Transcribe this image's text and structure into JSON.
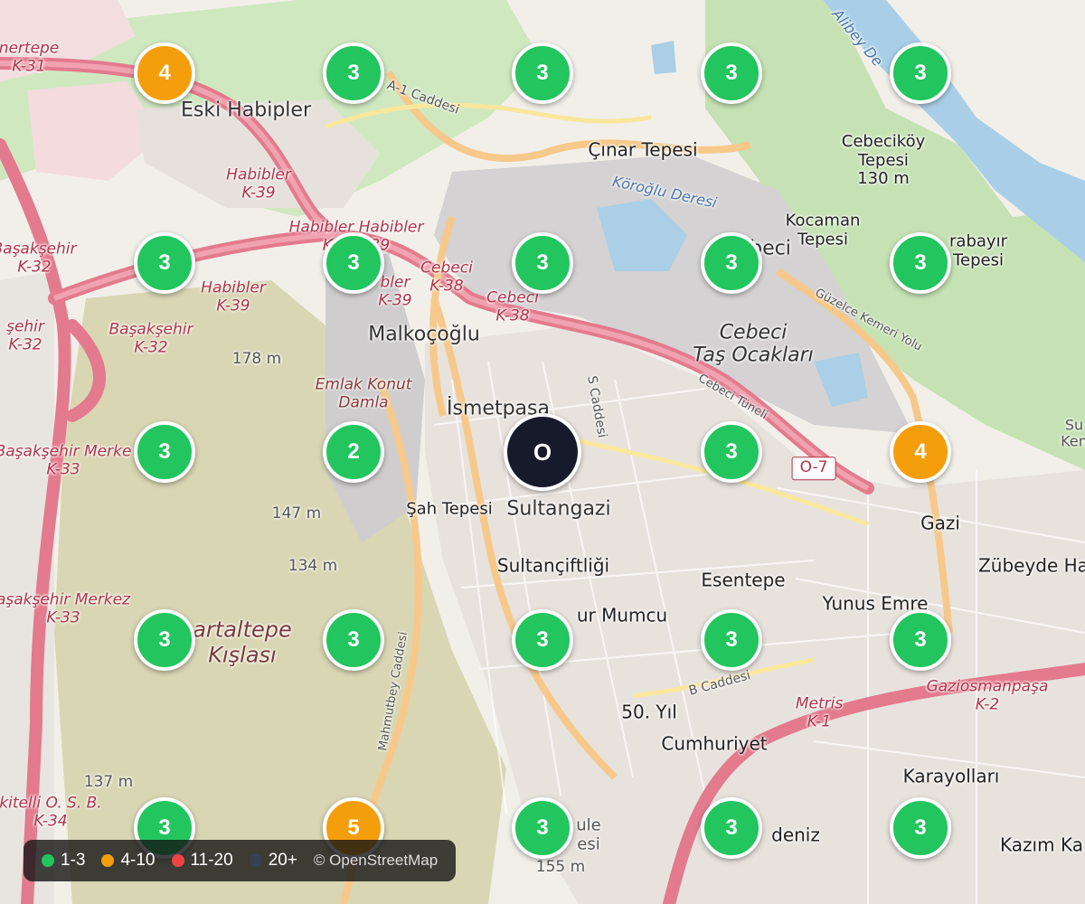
{
  "map": {
    "places": [
      {
        "id": "place-eski-habipler",
        "text": "Eski Habipler"
      },
      {
        "id": "place-malkocoglu",
        "text": "Malkoçoğlu"
      },
      {
        "id": "place-ismetpasa",
        "text": "İsmetpaşa"
      },
      {
        "id": "place-sultangazi",
        "text": "Sultangazi"
      },
      {
        "id": "place-sultanciftligi",
        "text": "Sultançiftliği"
      },
      {
        "id": "place-ugur-mumcu",
        "text": "ur Mumcu"
      },
      {
        "id": "place-esentepe",
        "text": "Esentepe"
      },
      {
        "id": "place-yunus-emre",
        "text": "Yunus Emre"
      },
      {
        "id": "place-gazi",
        "text": "Gazi"
      },
      {
        "id": "place-zubeyde",
        "text": "Zübeyde Ha"
      },
      {
        "id": "place-50-yil",
        "text": "50. Yıl"
      },
      {
        "id": "place-cumhuriyet",
        "text": "Cumhuriyet"
      },
      {
        "id": "place-karayollari",
        "text": "Karayolları"
      },
      {
        "id": "place-kazim-ka",
        "text": "Kazım Ka"
      },
      {
        "id": "place-deniz",
        "text": "deniz"
      },
      {
        "id": "place-emlak-konut",
        "text": "Emlak Konut\nDamla"
      },
      {
        "id": "place-cebeci-tas",
        "text": "Cebeci\nTaş Ocakları"
      },
      {
        "id": "place-cinar-tepesi",
        "text": "Çınar Tepesi"
      },
      {
        "id": "place-cebecikoy",
        "text": "Cebeciköy\nTepesi\n130 m"
      },
      {
        "id": "place-kocaman",
        "text": "Kocaman\nTepesi"
      },
      {
        "id": "place-arabayir",
        "text": "rabayır\nTepesi"
      },
      {
        "id": "place-sah-tepesi",
        "text": "Şah Tepesi"
      },
      {
        "id": "place-kartaltepe",
        "text": "artaltepe\nKışlası"
      },
      {
        "id": "place-elev-178",
        "text": "178 m"
      },
      {
        "id": "place-elev-147",
        "text": "147 m"
      },
      {
        "id": "place-elev-134",
        "text": "134 m"
      },
      {
        "id": "place-elev-137",
        "text": "137 m"
      },
      {
        "id": "place-elev-155",
        "text": "155 m"
      },
      {
        "id": "place-ule",
        "text": "ule\nesi"
      },
      {
        "id": "place-ken",
        "text": "Su\nKen"
      },
      {
        "id": "place-beci",
        "text": "beci"
      }
    ],
    "roads": [
      {
        "id": "road-nertepe",
        "text": "nertepe\nK-31"
      },
      {
        "id": "road-habibler-k39-a",
        "text": "Habibler\nK-39"
      },
      {
        "id": "road-habibler-habibler",
        "text": "Habibler Habibler\nK-3  K-39"
      },
      {
        "id": "road-habibler-k39-b",
        "text": "Habibler\nK-39"
      },
      {
        "id": "road-bler-k39",
        "text": "bler\nK-39"
      },
      {
        "id": "road-cebeci-k38-a",
        "text": "Cebeci\nK-38"
      },
      {
        "id": "road-cebeci-k38-b",
        "text": "Cebeci\nK-38"
      },
      {
        "id": "road-basaksehir-k32-a",
        "text": "Başakşehir\nK-32"
      },
      {
        "id": "road-basaksehir-k32-b",
        "text": "Başakşehir\nK-32"
      },
      {
        "id": "road-sehir-k32",
        "text": "şehir\nK-32"
      },
      {
        "id": "road-basaksehir-merkez-k33-a",
        "text": "Başakşehir Merke\nK-33"
      },
      {
        "id": "road-basaksehir-merkez-k33-b",
        "text": "aşakşehir Merkez\nK-33"
      },
      {
        "id": "road-ikitelli",
        "text": "kitelli O. S. B.\nK-34"
      },
      {
        "id": "road-metris",
        "text": "Metris\nK-1"
      },
      {
        "id": "road-gaziosmanpasa",
        "text": "Gaziosmanpaşa\nK-2"
      },
      {
        "id": "road-a1-caddesi",
        "text": "A-1 Caddesi"
      },
      {
        "id": "road-s-caddesi",
        "text": "S Caddesi"
      },
      {
        "id": "road-b-caddesi",
        "text": "B Caddesi"
      },
      {
        "id": "road-guzelce",
        "text": "Güzelce Kemeri Yolu"
      },
      {
        "id": "road-cebeci-tuneli",
        "text": "Cebeci Tüneli"
      },
      {
        "id": "road-mahmutbey",
        "text": "Mahmutbey Caddesi"
      },
      {
        "id": "road-alibey",
        "text": "Alibey De"
      },
      {
        "id": "road-koroglu",
        "text": "Köroğlu Deresi"
      },
      {
        "id": "road-o7",
        "text": "O-7"
      }
    ],
    "markers": [
      {
        "id": "m-0-0",
        "count": "4",
        "level": "mid"
      },
      {
        "id": "m-0-1",
        "count": "3",
        "level": "low"
      },
      {
        "id": "m-0-2",
        "count": "3",
        "level": "low"
      },
      {
        "id": "m-0-3",
        "count": "3",
        "level": "low"
      },
      {
        "id": "m-0-4",
        "count": "3",
        "level": "low"
      },
      {
        "id": "m-1-0",
        "count": "3",
        "level": "low"
      },
      {
        "id": "m-1-1",
        "count": "3",
        "level": "low"
      },
      {
        "id": "m-1-2",
        "count": "3",
        "level": "low"
      },
      {
        "id": "m-1-3",
        "count": "3",
        "level": "low"
      },
      {
        "id": "m-1-4",
        "count": "3",
        "level": "low"
      },
      {
        "id": "m-2-0",
        "count": "3",
        "level": "low"
      },
      {
        "id": "m-2-1",
        "count": "2",
        "level": "low"
      },
      {
        "id": "m-2-2",
        "count": "O",
        "level": "center"
      },
      {
        "id": "m-2-3",
        "count": "3",
        "level": "low"
      },
      {
        "id": "m-2-4",
        "count": "4",
        "level": "mid"
      },
      {
        "id": "m-3-0",
        "count": "3",
        "level": "low"
      },
      {
        "id": "m-3-1",
        "count": "3",
        "level": "low"
      },
      {
        "id": "m-3-2",
        "count": "3",
        "level": "low"
      },
      {
        "id": "m-3-3",
        "count": "3",
        "level": "low"
      },
      {
        "id": "m-3-4",
        "count": "3",
        "level": "low"
      },
      {
        "id": "m-4-0",
        "count": "3",
        "level": "low"
      },
      {
        "id": "m-4-1",
        "count": "5",
        "level": "mid"
      },
      {
        "id": "m-4-2",
        "count": "3",
        "level": "low"
      },
      {
        "id": "m-4-3",
        "count": "3",
        "level": "low"
      },
      {
        "id": "m-4-4",
        "count": "3",
        "level": "low"
      }
    ]
  },
  "colors": {
    "low": "#22c55e",
    "mid": "#f59e0b",
    "high": "#ef4444",
    "max": "#374151",
    "center": "#161a2b"
  },
  "legend": {
    "items": [
      {
        "label": "1-3",
        "level": "low"
      },
      {
        "label": "4-10",
        "level": "mid"
      },
      {
        "label": "11-20",
        "level": "high"
      },
      {
        "label": "20+",
        "level": "max"
      }
    ],
    "attribution": "© OpenStreetMap"
  }
}
